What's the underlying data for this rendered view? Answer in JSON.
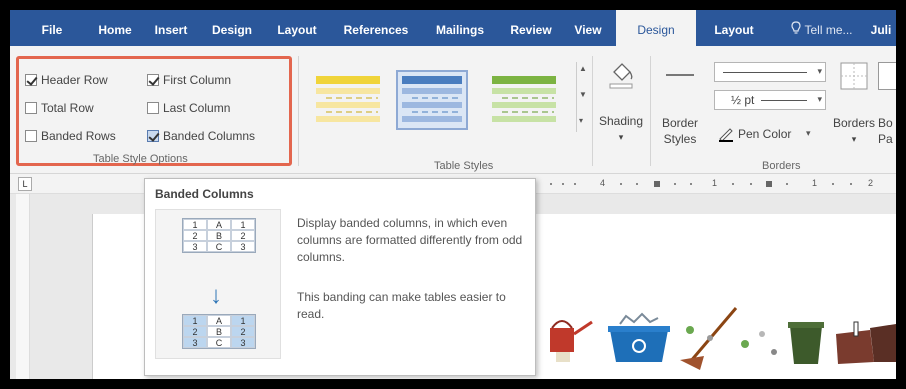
{
  "tabs": [
    {
      "label": "File",
      "active": false
    },
    {
      "label": "Home",
      "active": false
    },
    {
      "label": "Insert",
      "active": false
    },
    {
      "label": "Design",
      "active": false
    },
    {
      "label": "Layout",
      "active": false
    },
    {
      "label": "References",
      "active": false
    },
    {
      "label": "Mailings",
      "active": false
    },
    {
      "label": "Review",
      "active": false
    },
    {
      "label": "View",
      "active": false
    },
    {
      "label": "Design",
      "active": true
    },
    {
      "label": "Layout",
      "active": false
    }
  ],
  "tell_me": "Tell me...",
  "user_partial": "Juli",
  "table_style_options": {
    "items": [
      {
        "label": "Header Row",
        "checked": true
      },
      {
        "label": "First Column",
        "checked": true
      },
      {
        "label": "Total Row",
        "checked": false
      },
      {
        "label": "Last Column",
        "checked": false
      },
      {
        "label": "Banded Rows",
        "checked": false
      },
      {
        "label": "Banded Columns",
        "checked": true
      }
    ],
    "group_label": "Table Style Options"
  },
  "table_styles": {
    "group_label": "Table Styles",
    "thumbs": [
      {
        "color": "#f0d43a",
        "selected": false
      },
      {
        "color": "#4a7dbf",
        "selected": true
      },
      {
        "color": "#7cb342",
        "selected": false
      }
    ]
  },
  "borders": {
    "shading": "Shading",
    "border_styles_1": "Border",
    "border_styles_2": "Styles",
    "weight": "½ pt",
    "pen_color": "Pen Color",
    "borders_btn": "Borders",
    "border_painter": "Bo",
    "border_painter_2": "Pa",
    "group_label": "Borders"
  },
  "ruler": {
    "corner": "L",
    "nums": [
      "4",
      "1",
      "1",
      "2"
    ]
  },
  "tooltip": {
    "title": "Banded Columns",
    "illus_top": [
      [
        "1",
        "A",
        "1"
      ],
      [
        "2",
        "B",
        "2"
      ],
      [
        "3",
        "C",
        "3"
      ]
    ],
    "illus_bottom": [
      [
        "1",
        "A",
        "1"
      ],
      [
        "2",
        "B",
        "2"
      ],
      [
        "3",
        "C",
        "3"
      ]
    ],
    "text1": "Display banded columns, in which even columns are formatted differently from odd columns.",
    "text2": "This banding can make tables easier to read."
  },
  "colors": {
    "ribbon_blue": "#2b579a",
    "highlight_border": "#e3664e",
    "arrow_blue": "#2e75b6"
  }
}
